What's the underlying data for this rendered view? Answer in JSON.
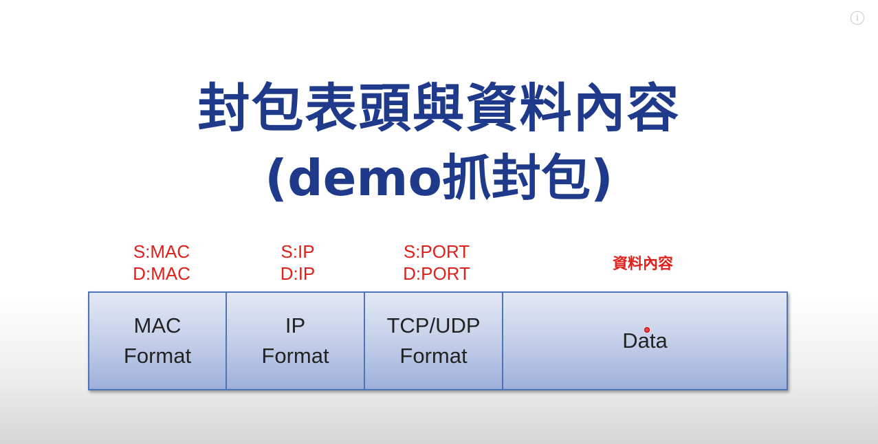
{
  "title": {
    "line1": "封包表頭與資料內容",
    "line2": "(demo抓封包)"
  },
  "header_labels": [
    {
      "line1": "S:MAC",
      "line2": "D:MAC"
    },
    {
      "line1": "S:IP",
      "line2": "D:IP"
    },
    {
      "line1": "S:PORT",
      "line2": "D:PORT"
    },
    {
      "line1": "資料內容"
    }
  ],
  "packet_fields": [
    {
      "line1": "MAC",
      "line2": "Format"
    },
    {
      "line1": "IP",
      "line2": "Format"
    },
    {
      "line1": "TCP/UDP",
      "line2": "Format"
    },
    {
      "line1": "Data"
    }
  ],
  "info_icon": {
    "icon": "info-icon",
    "glyph": "i"
  },
  "colors": {
    "title": "#1f3a8a",
    "labels": "#e0201b",
    "box_border": "#4e74b8",
    "box_fill": "#c8d2ea"
  }
}
